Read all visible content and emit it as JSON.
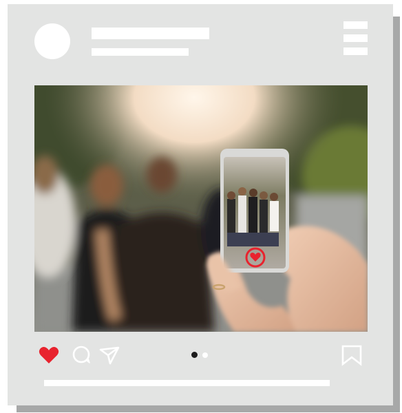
{
  "post": {
    "author_avatar": "avatar-placeholder",
    "image_description_icon": "photo",
    "icons": {
      "like": "heart-icon",
      "comment": "comment-bubble-icon",
      "share": "paper-plane-icon",
      "save": "bookmark-icon",
      "menu": "hamburger-menu-icon"
    },
    "carousel": {
      "total": 2,
      "current": 1
    },
    "liked": true
  },
  "colors": {
    "card": "#e3e4e3",
    "shadow": "#a7a8a8",
    "like": "#e8232e",
    "placeholder": "#ffffff"
  }
}
